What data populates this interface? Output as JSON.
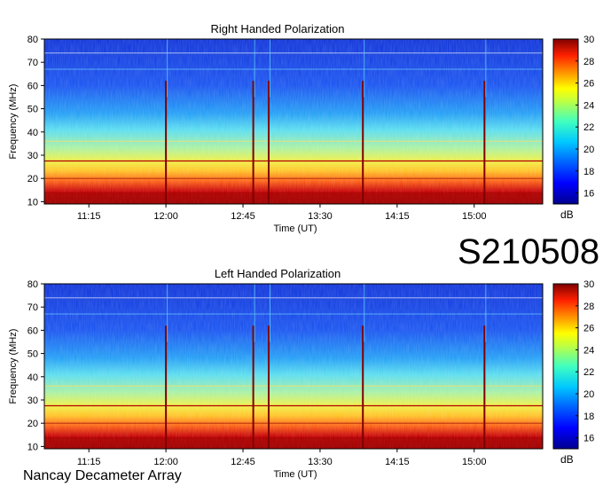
{
  "observation_id": "S210508",
  "footer_label": "Nancay Decameter Array",
  "colors": {
    "colormap": [
      "#00008f",
      "#0000ff",
      "#0080ff",
      "#00ffff",
      "#80ff80",
      "#ffff00",
      "#ff8000",
      "#ff0000",
      "#800000"
    ]
  },
  "chart_data": [
    {
      "type": "heatmap",
      "title": "Right Handed Polarization",
      "xlabel": "Time (UT)",
      "ylabel": "Frequency (MHz)",
      "x_ticks": [
        "11:15",
        "12:00",
        "12:45",
        "13:30",
        "14:15",
        "15:00"
      ],
      "y_ticks": [
        10,
        20,
        30,
        40,
        50,
        60,
        70,
        80
      ],
      "ylim": [
        9,
        80
      ],
      "colorbar": {
        "ticks": [
          16,
          18,
          20,
          22,
          24,
          26,
          28,
          30
        ],
        "range": [
          15,
          30
        ],
        "unit": "dB"
      },
      "bursts_utc": [
        "12:00",
        "12:51",
        "13:00",
        "13:55",
        "15:06"
      ]
    },
    {
      "type": "heatmap",
      "title": "Left Handed Polarization",
      "xlabel": "Time (UT)",
      "ylabel": "Frequency (MHz)",
      "x_ticks": [
        "11:15",
        "12:00",
        "12:45",
        "13:30",
        "14:15",
        "15:00"
      ],
      "y_ticks": [
        10,
        20,
        30,
        40,
        50,
        60,
        70,
        80
      ],
      "ylim": [
        9,
        80
      ],
      "colorbar": {
        "ticks": [
          16,
          18,
          20,
          22,
          24,
          26,
          28,
          30
        ],
        "range": [
          15,
          30
        ],
        "unit": "dB"
      },
      "bursts_utc": [
        "12:00",
        "12:51",
        "13:00",
        "13:55",
        "15:06"
      ]
    }
  ]
}
